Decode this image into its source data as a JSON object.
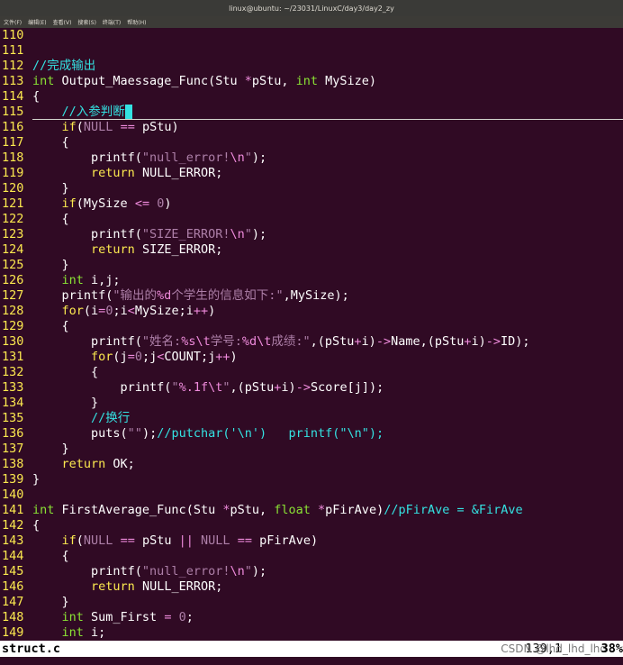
{
  "window": {
    "title": "linux@ubuntu: ~/23031/LinuxC/day3/day2_zy"
  },
  "menu": [
    {
      "label": "文件(F)"
    },
    {
      "label": "编辑(E)"
    },
    {
      "label": "查看(V)"
    },
    {
      "label": "搜索(S)"
    },
    {
      "label": "终端(T)"
    },
    {
      "label": "帮助(H)"
    }
  ],
  "editor": {
    "cursor_line": "115",
    "lines": [
      {
        "n": "110",
        "t": []
      },
      {
        "n": "111",
        "t": []
      },
      {
        "n": "112",
        "t": [
          [
            "comment",
            "//完成输出"
          ]
        ]
      },
      {
        "n": "113",
        "t": [
          [
            "type",
            "int"
          ],
          [
            "plain",
            " Output_Maessage_Func(Stu "
          ],
          [
            "op",
            "*"
          ],
          [
            "plain",
            "pStu, "
          ],
          [
            "type",
            "int"
          ],
          [
            "plain",
            " MySize)"
          ]
        ]
      },
      {
        "n": "114",
        "t": [
          [
            "plain",
            "{"
          ]
        ]
      },
      {
        "n": "115",
        "t": [
          [
            "plain",
            "    "
          ],
          [
            "comment",
            "//入参判断"
          ],
          [
            "cursor",
            " "
          ]
        ]
      },
      {
        "n": "116",
        "t": [
          [
            "plain",
            "    "
          ],
          [
            "keyword",
            "if"
          ],
          [
            "plain",
            "("
          ],
          [
            "number",
            "NULL"
          ],
          [
            "plain",
            " "
          ],
          [
            "op",
            "=="
          ],
          [
            "plain",
            " pStu)"
          ]
        ]
      },
      {
        "n": "117",
        "t": [
          [
            "plain",
            "    {"
          ]
        ]
      },
      {
        "n": "118",
        "t": [
          [
            "plain",
            "        printf("
          ],
          [
            "string",
            "\"null_error!"
          ],
          [
            "escape",
            "\\n"
          ],
          [
            "string",
            "\""
          ],
          [
            "plain",
            ");"
          ]
        ]
      },
      {
        "n": "119",
        "t": [
          [
            "plain",
            "        "
          ],
          [
            "keyword",
            "return"
          ],
          [
            "plain",
            " NULL_ERROR;"
          ]
        ]
      },
      {
        "n": "120",
        "t": [
          [
            "plain",
            "    }"
          ]
        ]
      },
      {
        "n": "121",
        "t": [
          [
            "plain",
            "    "
          ],
          [
            "keyword",
            "if"
          ],
          [
            "plain",
            "(MySize "
          ],
          [
            "op",
            "<="
          ],
          [
            "plain",
            " "
          ],
          [
            "number",
            "0"
          ],
          [
            "plain",
            ")"
          ]
        ]
      },
      {
        "n": "122",
        "t": [
          [
            "plain",
            "    {"
          ]
        ]
      },
      {
        "n": "123",
        "t": [
          [
            "plain",
            "        printf("
          ],
          [
            "string",
            "\"SIZE_ERROR!"
          ],
          [
            "escape",
            "\\n"
          ],
          [
            "string",
            "\""
          ],
          [
            "plain",
            ");"
          ]
        ]
      },
      {
        "n": "124",
        "t": [
          [
            "plain",
            "        "
          ],
          [
            "keyword",
            "return"
          ],
          [
            "plain",
            " SIZE_ERROR;"
          ]
        ]
      },
      {
        "n": "125",
        "t": [
          [
            "plain",
            "    }"
          ]
        ]
      },
      {
        "n": "126",
        "t": [
          [
            "plain",
            "    "
          ],
          [
            "type",
            "int"
          ],
          [
            "plain",
            " i,j;"
          ]
        ]
      },
      {
        "n": "127",
        "t": [
          [
            "plain",
            "    printf("
          ],
          [
            "string",
            "\"输出的"
          ],
          [
            "escape",
            "%d"
          ],
          [
            "string",
            "个学生的信息如下:\""
          ],
          [
            "plain",
            ",MySize);"
          ]
        ]
      },
      {
        "n": "128",
        "t": [
          [
            "plain",
            "    "
          ],
          [
            "keyword",
            "for"
          ],
          [
            "plain",
            "(i"
          ],
          [
            "op",
            "="
          ],
          [
            "number",
            "0"
          ],
          [
            "plain",
            ";i"
          ],
          [
            "op",
            "<"
          ],
          [
            "plain",
            "MySize;i"
          ],
          [
            "op",
            "++"
          ],
          [
            "plain",
            ")"
          ]
        ]
      },
      {
        "n": "129",
        "t": [
          [
            "plain",
            "    {"
          ]
        ]
      },
      {
        "n": "130",
        "t": [
          [
            "plain",
            "        printf("
          ],
          [
            "string",
            "\"姓名:"
          ],
          [
            "escape",
            "%s\\t"
          ],
          [
            "string",
            "学号:"
          ],
          [
            "escape",
            "%d\\t"
          ],
          [
            "string",
            "成绩:\""
          ],
          [
            "plain",
            ",(pStu"
          ],
          [
            "op",
            "+"
          ],
          [
            "plain",
            "i)"
          ],
          [
            "op",
            "->"
          ],
          [
            "plain",
            "Name,(pStu"
          ],
          [
            "op",
            "+"
          ],
          [
            "plain",
            "i)"
          ],
          [
            "op",
            "->"
          ],
          [
            "plain",
            "ID);"
          ]
        ]
      },
      {
        "n": "131",
        "t": [
          [
            "plain",
            "        "
          ],
          [
            "keyword",
            "for"
          ],
          [
            "plain",
            "(j"
          ],
          [
            "op",
            "="
          ],
          [
            "number",
            "0"
          ],
          [
            "plain",
            ";j"
          ],
          [
            "op",
            "<"
          ],
          [
            "plain",
            "COUNT;j"
          ],
          [
            "op",
            "++"
          ],
          [
            "plain",
            ")"
          ]
        ]
      },
      {
        "n": "132",
        "t": [
          [
            "plain",
            "        {"
          ]
        ]
      },
      {
        "n": "133",
        "t": [
          [
            "plain",
            "            printf("
          ],
          [
            "string",
            "\""
          ],
          [
            "escape",
            "%.1f\\t"
          ],
          [
            "string",
            "\""
          ],
          [
            "plain",
            ",(pStu"
          ],
          [
            "op",
            "+"
          ],
          [
            "plain",
            "i)"
          ],
          [
            "op",
            "->"
          ],
          [
            "plain",
            "Score[j]);"
          ]
        ]
      },
      {
        "n": "134",
        "t": [
          [
            "plain",
            "        }"
          ]
        ]
      },
      {
        "n": "135",
        "t": [
          [
            "plain",
            "        "
          ],
          [
            "comment",
            "//换行"
          ]
        ]
      },
      {
        "n": "136",
        "t": [
          [
            "plain",
            "        puts("
          ],
          [
            "string",
            "\"\""
          ],
          [
            "plain",
            ");"
          ],
          [
            "comment",
            "//putchar('\\n')   printf(\"\\n\");"
          ]
        ]
      },
      {
        "n": "137",
        "t": [
          [
            "plain",
            "    }"
          ]
        ]
      },
      {
        "n": "138",
        "t": [
          [
            "plain",
            "    "
          ],
          [
            "keyword",
            "return"
          ],
          [
            "plain",
            " OK;"
          ]
        ]
      },
      {
        "n": "139",
        "t": [
          [
            "plain",
            "}"
          ]
        ]
      },
      {
        "n": "140",
        "t": []
      },
      {
        "n": "141",
        "t": [
          [
            "type",
            "int"
          ],
          [
            "plain",
            " FirstAverage_Func(Stu "
          ],
          [
            "op",
            "*"
          ],
          [
            "plain",
            "pStu, "
          ],
          [
            "type",
            "float"
          ],
          [
            "plain",
            " "
          ],
          [
            "op",
            "*"
          ],
          [
            "plain",
            "pFirAve)"
          ],
          [
            "comment",
            "//pFirAve = &FirAve"
          ]
        ]
      },
      {
        "n": "142",
        "t": [
          [
            "plain",
            "{"
          ]
        ]
      },
      {
        "n": "143",
        "t": [
          [
            "plain",
            "    "
          ],
          [
            "keyword",
            "if"
          ],
          [
            "plain",
            "("
          ],
          [
            "number",
            "NULL"
          ],
          [
            "plain",
            " "
          ],
          [
            "op",
            "=="
          ],
          [
            "plain",
            " pStu "
          ],
          [
            "op",
            "||"
          ],
          [
            "plain",
            " "
          ],
          [
            "number",
            "NULL"
          ],
          [
            "plain",
            " "
          ],
          [
            "op",
            "=="
          ],
          [
            "plain",
            " pFirAve)"
          ]
        ]
      },
      {
        "n": "144",
        "t": [
          [
            "plain",
            "    {"
          ]
        ]
      },
      {
        "n": "145",
        "t": [
          [
            "plain",
            "        printf("
          ],
          [
            "string",
            "\"null_error!"
          ],
          [
            "escape",
            "\\n"
          ],
          [
            "string",
            "\""
          ],
          [
            "plain",
            ");"
          ]
        ]
      },
      {
        "n": "146",
        "t": [
          [
            "plain",
            "        "
          ],
          [
            "keyword",
            "return"
          ],
          [
            "plain",
            " NULL_ERROR;"
          ]
        ]
      },
      {
        "n": "147",
        "t": [
          [
            "plain",
            "    }"
          ]
        ]
      },
      {
        "n": "148",
        "t": [
          [
            "plain",
            "    "
          ],
          [
            "type",
            "int"
          ],
          [
            "plain",
            " Sum_First "
          ],
          [
            "op",
            "="
          ],
          [
            "plain",
            " "
          ],
          [
            "number",
            "0"
          ],
          [
            "plain",
            ";"
          ]
        ]
      },
      {
        "n": "149",
        "t": [
          [
            "plain",
            "    "
          ],
          [
            "type",
            "int"
          ],
          [
            "plain",
            " i;"
          ]
        ]
      }
    ]
  },
  "status": {
    "filename": "struct.c",
    "position": "139,1",
    "watermark": "CSDN @lhd_lhd_lhd",
    "percent": "38%"
  }
}
